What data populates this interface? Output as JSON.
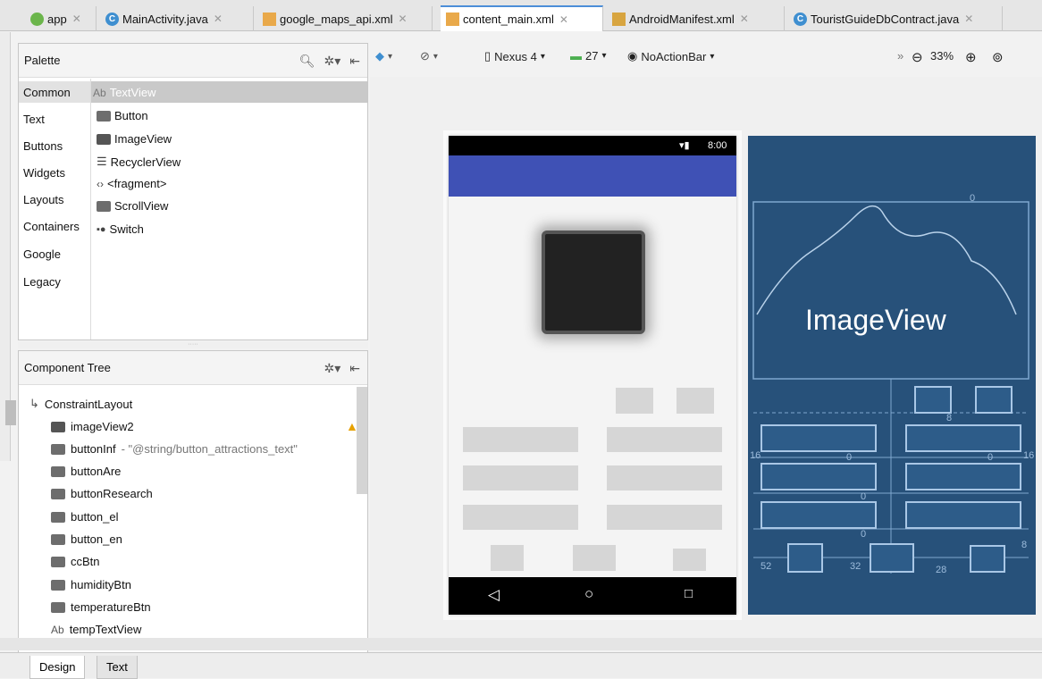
{
  "tabs": [
    {
      "label": "app",
      "icon": "app-module-icon"
    },
    {
      "label": "MainActivity.java",
      "icon": "class-icon"
    },
    {
      "label": "google_maps_api.xml",
      "icon": "xml-file-icon"
    },
    {
      "label": "content_main.xml",
      "icon": "xml-file-icon",
      "active": true
    },
    {
      "label": "AndroidManifest.xml",
      "icon": "manifest-icon"
    },
    {
      "label": "TouristGuideDbContract.java",
      "icon": "class-icon"
    }
  ],
  "palette": {
    "title": "Palette",
    "categories": [
      "Common",
      "Text",
      "Buttons",
      "Widgets",
      "Layouts",
      "Containers",
      "Google",
      "Legacy"
    ],
    "items": [
      "TextView",
      "Button",
      "ImageView",
      "RecyclerView",
      "<fragment>",
      "ScrollView",
      "Switch"
    ],
    "textview_prefix": "Ab"
  },
  "component_tree": {
    "title": "Component Tree",
    "root": "ConstraintLayout",
    "items": [
      {
        "name": "imageView2",
        "warning": true
      },
      {
        "name": "buttonInf",
        "detail": "- \"@string/button_attractions_text\""
      },
      {
        "name": "buttonAre"
      },
      {
        "name": "buttonResearch"
      },
      {
        "name": "button_el"
      },
      {
        "name": "button_en"
      },
      {
        "name": "ccBtn"
      },
      {
        "name": "humidityBtn"
      },
      {
        "name": "temperatureBtn"
      },
      {
        "name": "tempTextView",
        "prefix": "Ab"
      }
    ]
  },
  "toolbar": {
    "device": "Nexus 4",
    "api": "27",
    "theme": "NoActionBar",
    "zoom": "33%"
  },
  "phone": {
    "time": "8:00"
  },
  "blueprint": {
    "image_label": "ImageView",
    "numbers": [
      "0",
      "8",
      "0",
      "0",
      "16",
      "0",
      "16",
      "0",
      "52",
      "32",
      "28",
      "8",
      "8"
    ]
  },
  "bottom_tabs": [
    "Design",
    "Text"
  ],
  "colors": {
    "appbar": "#3f51b5",
    "blueprint": "#27517a",
    "accent": "#4c8ed8"
  }
}
